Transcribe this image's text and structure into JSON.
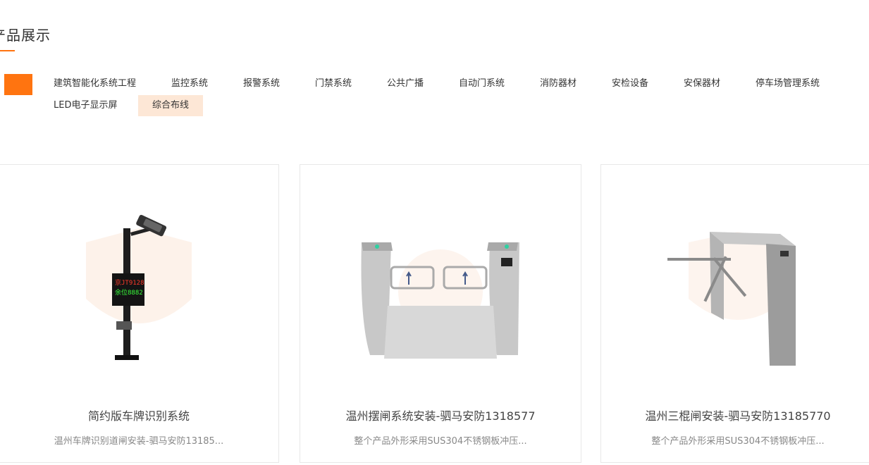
{
  "section": {
    "title": "产品展示"
  },
  "categories": [
    {
      "label": "建筑智能化系统工程"
    },
    {
      "label": "监控系统"
    },
    {
      "label": "报警系统"
    },
    {
      "label": "门禁系统"
    },
    {
      "label": "公共广播"
    },
    {
      "label": "自动门系统"
    },
    {
      "label": "消防器材"
    },
    {
      "label": "安检设备"
    },
    {
      "label": "安保器材"
    },
    {
      "label": "停车场管理系统"
    },
    {
      "label": "LED电子显示屏"
    },
    {
      "label": "综合布线",
      "active": true
    }
  ],
  "accent_color": "#ff7410",
  "products": [
    {
      "title": "简约版车牌识别系统",
      "desc": "温州车牌识别道闸安装-驷马安防13185...",
      "image_icon": "license-plate-camera-pole",
      "screen_text_1": "京JT9128",
      "screen_text_2": "余位8882"
    },
    {
      "title": "温州摆闸系统安装-驷马安防1318577",
      "desc": "整个产品外形采用SUS304不锈钢板冲压...",
      "image_icon": "swing-gate-turnstile"
    },
    {
      "title": "温州三棍闸安装-驷马安防13185770",
      "desc": "整个产品外形采用SUS304不锈钢板冲压...",
      "image_icon": "tripod-turnstile"
    }
  ]
}
